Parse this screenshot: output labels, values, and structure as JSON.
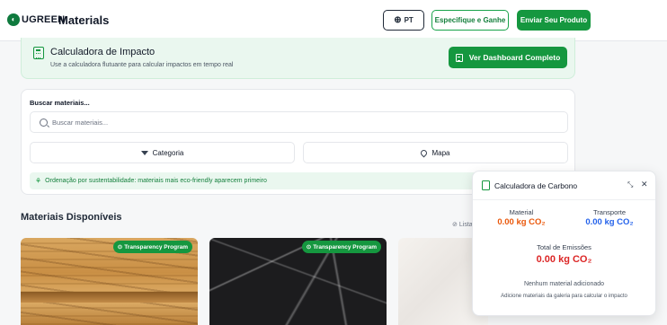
{
  "header": {
    "logo_text": "UGREEN",
    "page_title": "Materials",
    "lang_label": "PT",
    "spec_label": "Especifique e Ganhe",
    "send_label": "Enviar Seu Produto"
  },
  "calculator_banner": {
    "title": "Calculadora de Impacto",
    "subtitle": "Use a calculadora flutuante para calcular impactos em tempo real",
    "dashboard_label": "Ver Dashboard Completo"
  },
  "search": {
    "label": "Buscar materiais...",
    "placeholder": "Buscar materiais...",
    "category_label": "Categoria",
    "map_label": "Mapa",
    "sort_text": "Ordenação por sustentabilidade: materiais mais eco-friendly aparecem primeiro"
  },
  "materials": {
    "section_title": "Materiais Disponíveis",
    "list_toggle": "Lista",
    "cards": [
      {
        "badge": "Transparency Program"
      },
      {
        "badge": "Transparency Program"
      },
      {
        "badge": ""
      }
    ]
  },
  "carbon_panel": {
    "title": "Calculadora de Carbono",
    "material_label": "Material",
    "material_value": "0.00 kg CO₂",
    "transport_label": "Transporte",
    "transport_value": "0.00 kg CO₂",
    "total_label": "Total de Emissões",
    "total_value": "0.00 kg CO₂",
    "empty_label": "Nenhum material adicionado",
    "empty_hint": "Adicione materiais da galeria para calcular o impacto"
  },
  "colors": {
    "brand_green": "#15973f",
    "material_orange": "#ea580c",
    "transport_blue": "#2563eb",
    "total_red": "#dc2626"
  },
  "icons": [
    "logo-icon",
    "globe-icon",
    "calculator-icon",
    "document-icon",
    "search-icon",
    "funnel-icon",
    "map-pin-icon",
    "leaf-icon",
    "link-icon",
    "check-circle-icon",
    "minimize-icon",
    "close-icon"
  ]
}
